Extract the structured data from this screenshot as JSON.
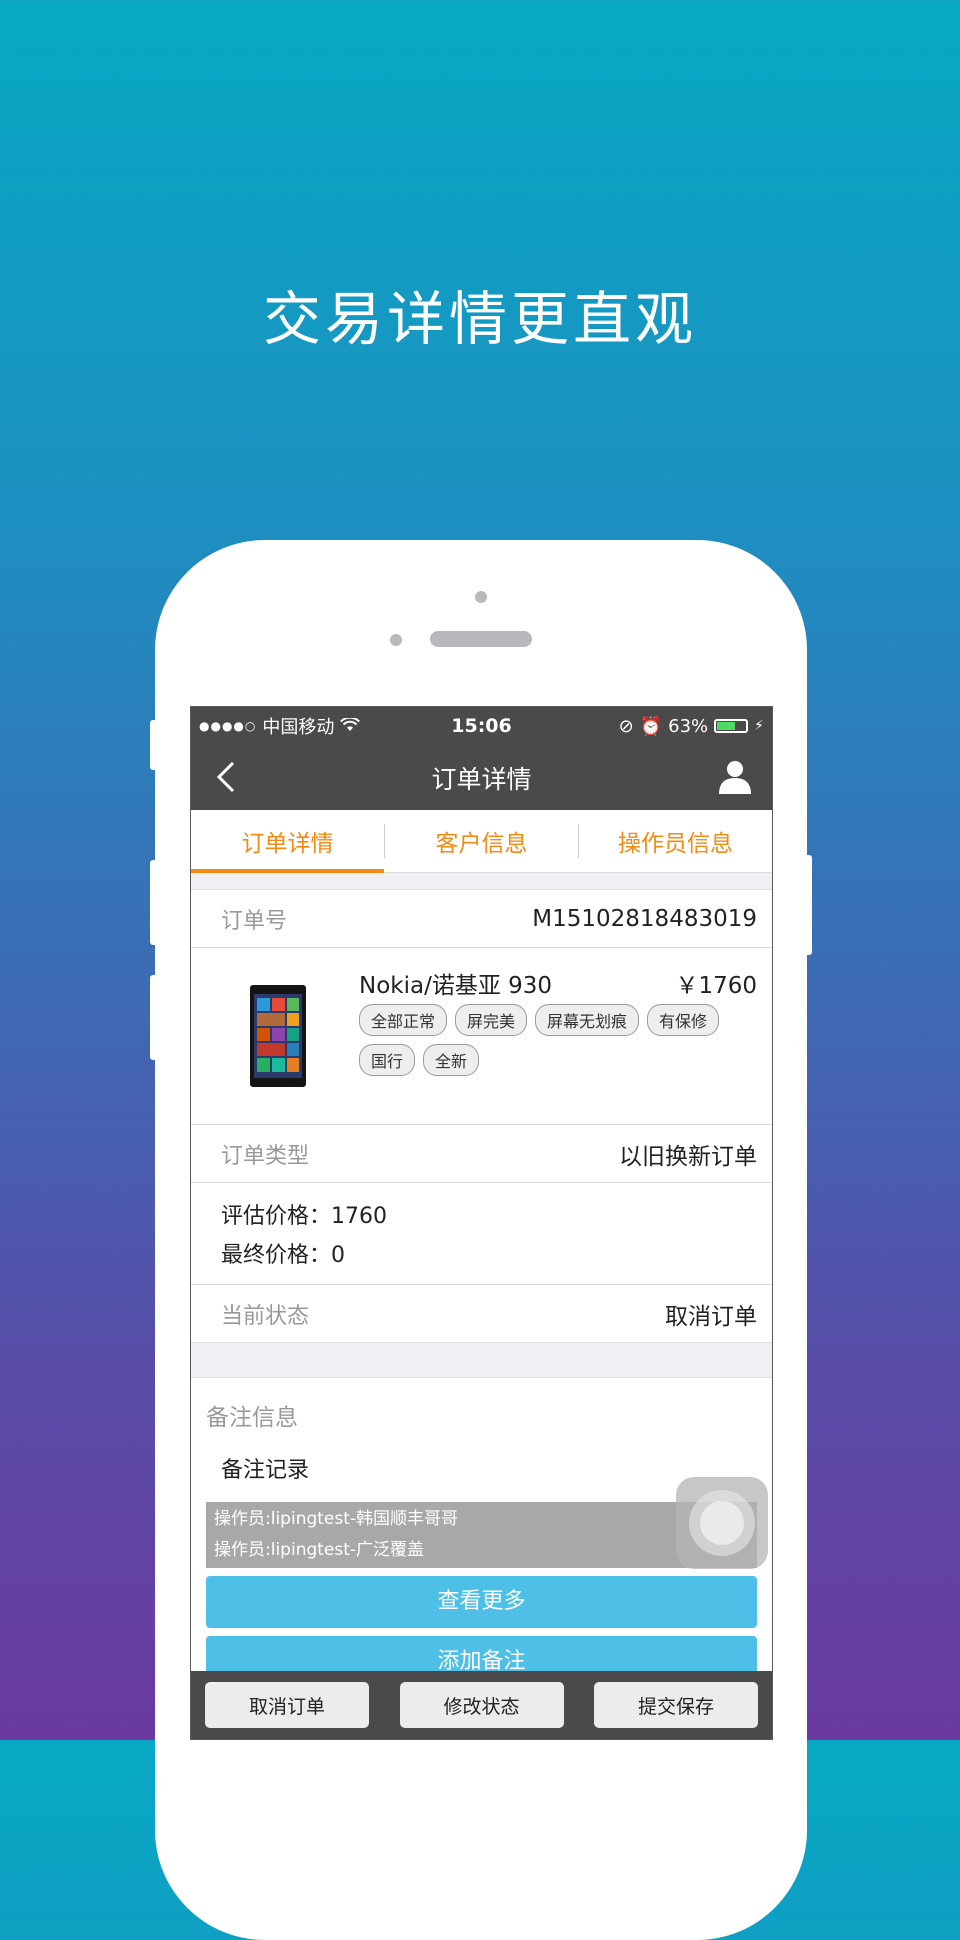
{
  "headline": "交易详情更直观",
  "status_bar": {
    "carrier": "中国移动",
    "time": "15:06",
    "battery_percent": "63%",
    "battery_level": 0.63
  },
  "nav": {
    "title": "订单详情",
    "back_icon": "chevron-left-icon",
    "user_icon": "user-icon"
  },
  "tabs": [
    {
      "label": "订单详情",
      "active": true
    },
    {
      "label": "客户信息",
      "active": false
    },
    {
      "label": "操作员信息",
      "active": false
    }
  ],
  "order": {
    "number_label": "订单号",
    "number": "M15102818483019",
    "product_name": "Nokia/诺基亚 930",
    "product_price": "￥1760",
    "tags": [
      "全部正常",
      "屏完美",
      "屏幕无划痕",
      "有保修",
      "国行",
      "全新"
    ],
    "type_label": "订单类型",
    "type_value": "以旧换新订单",
    "estimate_label": "评估价格：",
    "estimate_value": "1760",
    "final_label": "最终价格：",
    "final_value": "0",
    "status_label": "当前状态",
    "status_value": "取消订单"
  },
  "notes": {
    "title": "备注信息",
    "records_label": "备注记录",
    "records": [
      "操作员:lipingtest-韩国顺丰哥哥",
      "操作员:lipingtest-广泛覆盖"
    ],
    "view_more": "查看更多",
    "add_note": "添加备注"
  },
  "bottom_bar": {
    "cancel": "取消订单",
    "modify": "修改状态",
    "submit": "提交保存"
  },
  "colors": {
    "accent_orange": "#f28a13",
    "button_blue": "#4ebfe6",
    "dark_bar": "#4a4a4a"
  }
}
